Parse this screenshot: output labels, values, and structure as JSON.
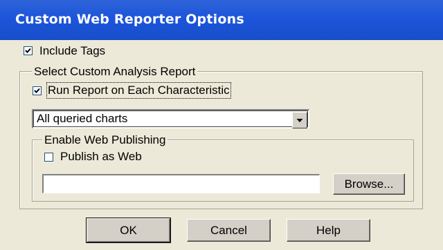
{
  "dialog": {
    "title": "Custom Web Reporter Options",
    "include_tags": {
      "label": "Include Tags",
      "checked": true
    },
    "custom_analysis": {
      "group_label": "Select Custom Analysis Report",
      "run_each": {
        "label": "Run Report on Each Characteristic",
        "checked": true
      },
      "chart_select": {
        "value": "All queried charts"
      }
    },
    "web_publishing": {
      "group_label": "Enable Web Publishing",
      "publish": {
        "label": "Publish as Web",
        "checked": false
      },
      "path_value": "",
      "browse_label": "Browse..."
    },
    "buttons": {
      "ok": "OK",
      "cancel": "Cancel",
      "help": "Help"
    }
  },
  "colors": {
    "titlebar": "#1D55DB",
    "dialog_bg": "#ECE9D8",
    "check_border": "#1C5180"
  }
}
